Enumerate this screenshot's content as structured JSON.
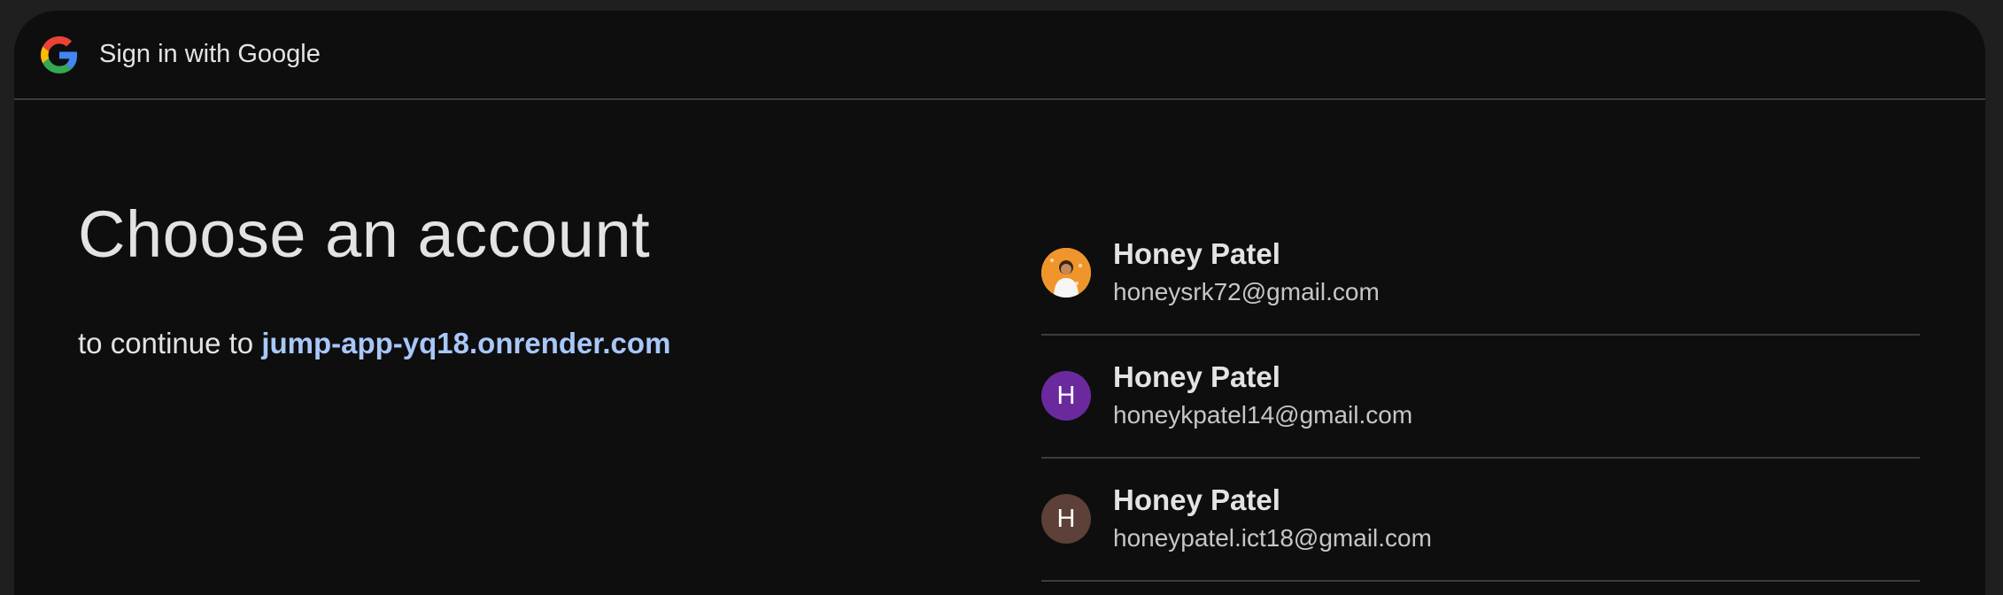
{
  "header": {
    "title": "Sign in with Google",
    "logo_icon": "google-g-icon"
  },
  "main": {
    "title": "Choose an account",
    "subtitle_prefix": "to continue to ",
    "app_link": "jump-app-yq18.onrender.com"
  },
  "accounts": [
    {
      "name": "Honey Patel",
      "email": "honeysrk72@gmail.com",
      "avatar_type": "photo",
      "avatar_letter": "",
      "avatar_color": "#f0952c"
    },
    {
      "name": "Honey Patel",
      "email": "honeykpatel14@gmail.com",
      "avatar_type": "letter",
      "avatar_letter": "H",
      "avatar_color": "#6a2a9e"
    },
    {
      "name": "Honey Patel",
      "email": "honeypatel.ict18@gmail.com",
      "avatar_type": "letter",
      "avatar_letter": "H",
      "avatar_color": "#5d4037"
    }
  ],
  "colors": {
    "background": "#0e0e0e",
    "text": "#e3e3e3",
    "link": "#a8c7fa",
    "divider": "#3c3c3c"
  }
}
